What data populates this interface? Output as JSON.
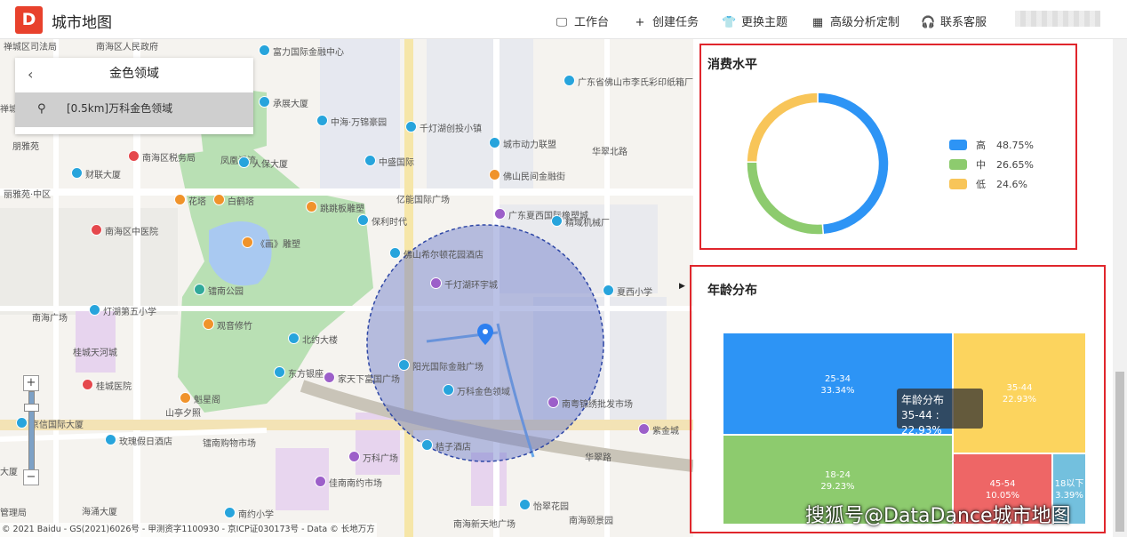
{
  "header": {
    "logo_text": "D",
    "title": "城市地图",
    "nav": [
      {
        "label": "工作台",
        "icon": "monitor-icon",
        "glyph": "🖵"
      },
      {
        "label": "创建任务",
        "icon": "plus-icon",
        "glyph": "+"
      },
      {
        "label": "更换主题",
        "icon": "shirt-icon",
        "glyph": "👕"
      },
      {
        "label": "高级分析定制",
        "icon": "calendar-icon",
        "glyph": "▦"
      },
      {
        "label": "联系客服",
        "icon": "headset-icon",
        "glyph": "🎧"
      }
    ]
  },
  "side_card": {
    "back_glyph": "‹",
    "title": "金色领域",
    "item_icon": "⚲",
    "item_label": "[0.5km]万科金色领域"
  },
  "map": {
    "zoom_in": "+",
    "zoom_out": "−",
    "copyright": "© 2021 Baidu - GS(2021)6026号 - 甲测资字1100930 - 京ICP证030173号 - Data © 长地万方",
    "labels": [
      {
        "text": "禅城区司法局",
        "pin": null
      },
      {
        "text": "南海区人民政府",
        "pin": null
      },
      {
        "text": "禅城区办",
        "pin": null
      },
      {
        "text": "富力国际金融中心",
        "pin": "blue"
      },
      {
        "text": "承展大厦",
        "pin": "blue"
      },
      {
        "text": "中海·万锦豪园",
        "pin": "blue"
      },
      {
        "text": "千灯湖创投小镇",
        "pin": "blue"
      },
      {
        "text": "城市动力联盟",
        "pin": "blue"
      },
      {
        "text": "广东省佛山市李氏彩印纸箱厂",
        "pin": "blue"
      },
      {
        "text": "朋雅苑",
        "pin": null
      },
      {
        "text": "南海区税务局",
        "pin": "red"
      },
      {
        "text": "凤凰溪流",
        "pin": null
      },
      {
        "text": "人保大厦",
        "pin": "blue"
      },
      {
        "text": "中盛国际",
        "pin": "blue"
      },
      {
        "text": "佛山民间金融街",
        "pin": "orange"
      },
      {
        "text": "华翠北路",
        "pin": null
      },
      {
        "text": "财联大厦",
        "pin": "blue"
      },
      {
        "text": "丽雅苑·中区",
        "pin": null
      },
      {
        "text": "花塔",
        "pin": "orange"
      },
      {
        "text": "白鹤塔",
        "pin": "orange"
      },
      {
        "text": "亿能国际广场",
        "pin": null
      },
      {
        "text": "跳跳板雕塑",
        "pin": "orange"
      },
      {
        "text": "保利时代",
        "pin": "blue"
      },
      {
        "text": "广东夏西国际橡塑城",
        "pin": "purple"
      },
      {
        "text": "精域机械厂",
        "pin": "blue"
      },
      {
        "text": "南海区中医院",
        "pin": "red"
      },
      {
        "text": "《画》雕塑",
        "pin": "orange"
      },
      {
        "text": "佛山希尔顿花园酒店",
        "pin": "blue"
      },
      {
        "text": "千灯湖环宇城",
        "pin": "purple"
      },
      {
        "text": "夏西小学",
        "pin": "blue"
      },
      {
        "text": "镭南公园",
        "pin": "teal"
      },
      {
        "text": "灯湖第五小学",
        "pin": "blue"
      },
      {
        "text": "南海广场",
        "pin": null
      },
      {
        "text": "观音修竹",
        "pin": "orange"
      },
      {
        "text": "北约大楼",
        "pin": "blue"
      },
      {
        "text": "桂城天河城",
        "pin": null
      },
      {
        "text": "东方银座",
        "pin": "blue"
      },
      {
        "text": "阳光国际金融广场",
        "pin": "blue"
      },
      {
        "text": "万科金色领域",
        "pin": "blue"
      },
      {
        "text": "家天下富国广场",
        "pin": "purple"
      },
      {
        "text": "南粤锦绣批发市场",
        "pin": "purple"
      },
      {
        "text": "魁星阁",
        "pin": "orange"
      },
      {
        "text": "桂城医院",
        "pin": "red"
      },
      {
        "text": "山亭夕照",
        "pin": null
      },
      {
        "text": "京信国际大厦",
        "pin": "blue"
      },
      {
        "text": "玫瑰假日酒店",
        "pin": "blue"
      },
      {
        "text": "镭南购物市场",
        "pin": null
      },
      {
        "text": "桔子酒店",
        "pin": "blue"
      },
      {
        "text": "紫金城",
        "pin": "purple"
      },
      {
        "text": "万科广场",
        "pin": "purple"
      },
      {
        "text": "华翠路",
        "pin": null
      },
      {
        "text": "佳南南约市场",
        "pin": "purple"
      },
      {
        "text": "怡翠花园",
        "pin": "blue"
      },
      {
        "text": "南海颐景园",
        "pin": null
      },
      {
        "text": "南约小学",
        "pin": "blue"
      },
      {
        "text": "海涌大厦",
        "pin": null
      },
      {
        "text": "南海新天地广场",
        "pin": null
      },
      {
        "text": "管理局",
        "pin": null
      },
      {
        "text": "大厦",
        "pin": null
      }
    ]
  },
  "consumption": {
    "title": "消费水平",
    "colors": {
      "high": "#2d94f5",
      "mid": "#8dcb6e",
      "low": "#f8c559"
    },
    "chart_data": {
      "type": "pie",
      "donut": true,
      "slices": [
        {
          "label": "高",
          "value": 48.75,
          "display": "48.75%",
          "color": "#2d94f5"
        },
        {
          "label": "中",
          "value": 26.65,
          "display": "26.65%",
          "color": "#8dcb6e"
        },
        {
          "label": "低",
          "value": 24.6,
          "display": "24.6%",
          "color": "#f8c559"
        }
      ],
      "legend_position": "right"
    }
  },
  "age": {
    "title": "年龄分布",
    "collapse_glyph": "▶",
    "tooltip": {
      "title": "年龄分布",
      "line": "35-44 : 22.93%"
    },
    "chart_data": {
      "type": "treemap",
      "items": [
        {
          "label": "25-34",
          "value": 33.34,
          "display": "33.34%",
          "color": "#2d94f5"
        },
        {
          "label": "18-24",
          "value": 29.23,
          "display": "29.23%",
          "color": "#8dcb6e"
        },
        {
          "label": "35-44",
          "value": 22.93,
          "display": "22.93%",
          "color": "#fcd45e"
        },
        {
          "label": "45-54",
          "value": 10.05,
          "display": "10.05%",
          "color": "#ee6666"
        },
        {
          "label": "18以下",
          "value": 3.39,
          "display": "3.39%",
          "color": "#73c0de"
        }
      ]
    }
  },
  "watermark": "搜狐号@DataDance城市地图"
}
